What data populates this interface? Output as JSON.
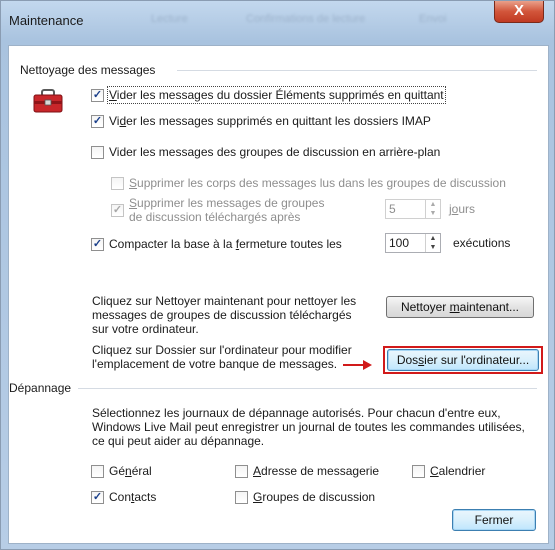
{
  "window": {
    "title": "Maintenance",
    "blurred_tabs": [
      "Lecture",
      "Confirmations de lecture",
      "Envoi"
    ],
    "close_glyph": "X"
  },
  "cleanup": {
    "heading": "Nettoyage des messages",
    "icon": "toolbox-icon",
    "empty_deleted": {
      "pre": "",
      "key": "V",
      "post": "ider les messages du dossier Éléments supprimés en quittant",
      "checked": true
    },
    "purge_imap": {
      "pre": "Vi",
      "key": "d",
      "post": "er les messages supprimés en quittant les dossiers IMAP",
      "checked": true
    },
    "empty_newsgroups": {
      "pre": "Vider les messages des ",
      "key": "g",
      "post": "roupes de discussion en arrière-plan",
      "checked": false
    },
    "delete_bodies": {
      "pre": "",
      "key": "S",
      "post": "upprimer les corps des messages lus dans les groupes de discussion",
      "checked": false,
      "disabled": true
    },
    "delete_newsgroup_msgs": {
      "line1_pre": "",
      "line1_key": "S",
      "line1_post": "upprimer les messages de groupes",
      "line2": "de discussion téléchargés après",
      "checked": true,
      "disabled": true,
      "value": "5",
      "unit_pre": "j",
      "unit_key": "o",
      "unit_post": "urs"
    },
    "compact": {
      "pre": "Compacter la base à la ",
      "key": "f",
      "post": "ermeture toutes les",
      "checked": true,
      "value": "100",
      "unit": "exécutions"
    },
    "clean_text": "Cliquez sur Nettoyer maintenant pour nettoyer les messages de groupes de discussion téléchargés sur votre ordinateur.",
    "clean_button": {
      "pre": "Nettoyer ",
      "key": "m",
      "post": "aintenant..."
    },
    "store_text": "Cliquez sur Dossier sur l'ordinateur pour modifier l'emplacement de votre banque de messages.",
    "store_button": {
      "pre": "Dos",
      "key": "s",
      "post": "ier sur l'ordinateur..."
    },
    "highlight_color": "#d11a1a"
  },
  "troubleshooting": {
    "heading": "Dépannage",
    "intro": "Sélectionnez les journaux de dépannage autorisés. Pour chacun d'entre eux, Windows Live Mail peut enregistrer un journal de toutes les commandes utilisées, ce qui peut aider au dépannage.",
    "general": {
      "pre": "Gé",
      "key": "n",
      "post": "éral",
      "checked": false
    },
    "mail": {
      "pre": "",
      "key": "A",
      "post": "dresse de messagerie",
      "checked": false
    },
    "calendar": {
      "pre": "",
      "key": "C",
      "post": "alendrier",
      "checked": false
    },
    "contacts": {
      "pre": "Con",
      "key": "t",
      "post": "acts",
      "checked": true
    },
    "newsgroups": {
      "pre": "",
      "key": "G",
      "post": "roupes de discussion",
      "checked": false
    },
    "close_button": "Fermer"
  }
}
